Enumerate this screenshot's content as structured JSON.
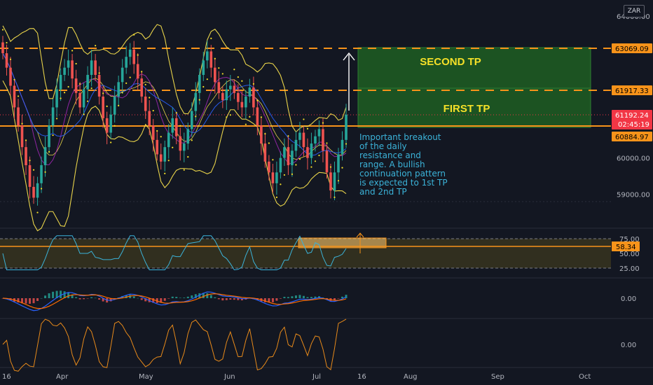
{
  "currency": "ZAR",
  "colors": {
    "background": "#131722",
    "candle_up": "#26a69a",
    "candle_down": "#ef5350",
    "bollinger": "#e8d34a",
    "target_line": "#f7931a",
    "tp_zone": "#1f5e22",
    "rsi_line": "#3bb3d9",
    "macd_line": "#2962ff",
    "signal_line": "#ff6d00",
    "osc_line": "#e88a1a",
    "note_text": "#3bb3d9"
  },
  "price_axis": {
    "ticks": [
      {
        "value": 64000,
        "label": "64000.00"
      },
      {
        "value": 60000,
        "label": "60000.00"
      },
      {
        "value": 59000,
        "label": "59000.00"
      }
    ],
    "badges": [
      {
        "id": "second-tp",
        "value": 63069.09,
        "label": "63069.09",
        "color": "#f7931a",
        "text": "#000000"
      },
      {
        "id": "first-tp",
        "value": 61917.33,
        "label": "61917.33",
        "color": "#f7931a",
        "text": "#000000"
      },
      {
        "id": "last-price",
        "value": 61192.24,
        "label": "61192.24",
        "countdown": "02:45:19",
        "color": "#f23645",
        "text": "#ffffff"
      },
      {
        "id": "breakout",
        "value": 60884.97,
        "label": "60884.97",
        "color": "#f7931a",
        "text": "#000000"
      }
    ]
  },
  "targets": {
    "second_tp_label": "SECOND TP",
    "first_tp_label": "FIRST TP"
  },
  "annotation": "Important breakout of the daily resistance and range. A bullish continuation pattern is expected to 1st TP and 2nd TP",
  "rsi_axis": {
    "ticks": [
      {
        "value": 75,
        "label": "75.00"
      },
      {
        "value": 50,
        "label": "50.00"
      },
      {
        "value": 25,
        "label": "25.00"
      }
    ],
    "badge": {
      "value": 58.34,
      "label": "58.34"
    }
  },
  "macd_axis": {
    "label": "0.00"
  },
  "osc_axis": {
    "label": "0.00"
  },
  "time_axis": {
    "labels": [
      "16",
      "Apr",
      "May",
      "Jun",
      "Jul",
      "16",
      "Aug",
      "Sep",
      "Oct"
    ]
  },
  "chart_data": {
    "type": "candlestick",
    "symbol_currency": "ZAR",
    "price_range": [
      58500,
      64000
    ],
    "x_labels": [
      "16",
      "Apr",
      "May",
      "Jun",
      "Jul",
      "16",
      "Aug",
      "Sep",
      "Oct"
    ],
    "levels": [
      {
        "name": "SECOND TP",
        "value": 63069.09
      },
      {
        "name": "FIRST TP",
        "value": 61917.33
      },
      {
        "name": "breakout",
        "value": 60884.97
      }
    ],
    "last_price": 61192.24,
    "close_series": [
      62900,
      62500,
      62000,
      61400,
      60900,
      60300,
      59800,
      59200,
      58900,
      59300,
      59800,
      60300,
      60900,
      61400,
      61900,
      62300,
      62500,
      62700,
      62200,
      61800,
      61400,
      61900,
      62300,
      62700,
      62300,
      61700,
      61100,
      60700,
      61200,
      61700,
      62100,
      62500,
      62800,
      63000,
      62600,
      62200,
      61700,
      61300,
      60900,
      60500,
      60100,
      59900,
      60300,
      60700,
      61100,
      60600,
      60200,
      60400,
      60800,
      61300,
      61800,
      62300,
      62700,
      62950,
      62500,
      62100,
      61800,
      61600,
      61900,
      62000,
      61800,
      61550,
      61400,
      61700,
      61950,
      61400,
      60900,
      60400,
      59900,
      59600,
      59300,
      59600,
      60000,
      60300,
      59800,
      60200,
      60500,
      60700,
      60300,
      60000,
      60400,
      60600,
      60800,
      60200,
      59600,
      59100,
      59600,
      60100,
      60500,
      61200
    ],
    "rsi": {
      "range": [
        0,
        100
      ],
      "levels": [
        75,
        50,
        25
      ],
      "last": 58.34
    },
    "indicators": [
      "Bollinger Bands",
      "Parabolic SAR",
      "Moving averages",
      "RSI",
      "MACD",
      "Oscillator"
    ]
  }
}
